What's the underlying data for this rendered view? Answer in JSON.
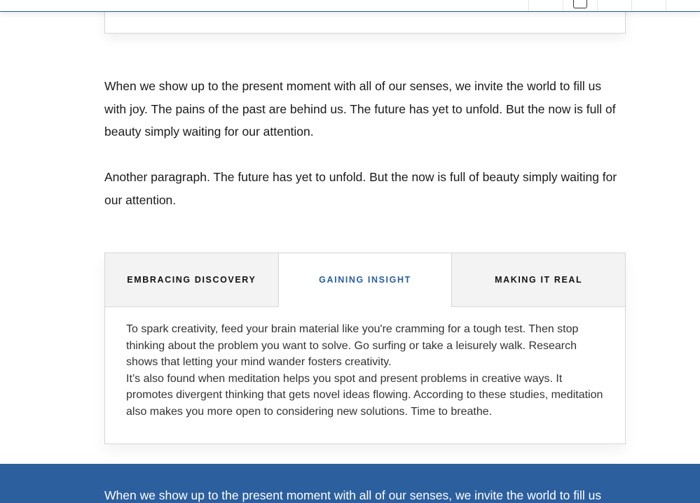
{
  "header": {
    "nav_icons": [
      "",
      "envelope-icon",
      "",
      "",
      ""
    ]
  },
  "content": {
    "paragraph_1": "When we show up to the present moment with all of our senses, we invite the world to fill us with joy. The pains of the past are behind us. The future has yet to unfold. But the now is full of beauty simply waiting for our attention.",
    "paragraph_2": "Another paragraph. The future has yet to unfold. But the now is full of beauty simply waiting for our attention."
  },
  "tabs": {
    "items": [
      {
        "label": "EMBRACING DISCOVERY",
        "active": false
      },
      {
        "label": "GAINING INSIGHT",
        "active": true
      },
      {
        "label": "MAKING IT REAL",
        "active": false
      }
    ],
    "active_panel": {
      "paragraph_1": "To spark creativity, feed your brain material like you're cramming for a tough test. Then stop thinking about the problem you want to solve. Go surfing or take a leisurely walk. Research shows that letting your mind wander fosters creativity.",
      "paragraph_2": "It’s also found when meditation helps you spot and present problems in creative ways. It promotes divergent thinking that gets novel ideas flowing. According to these studies, meditation also makes you more open to considering new solutions. Time to breathe."
    }
  },
  "blue_band": {
    "text": "When we show up to the present moment with all of our senses, we invite the world to fill us"
  },
  "colors": {
    "accent": "#2a5f9e",
    "band": "#2b5f9e",
    "tab_inactive_bg": "#f3f3f3",
    "border": "#d6d6d6"
  }
}
